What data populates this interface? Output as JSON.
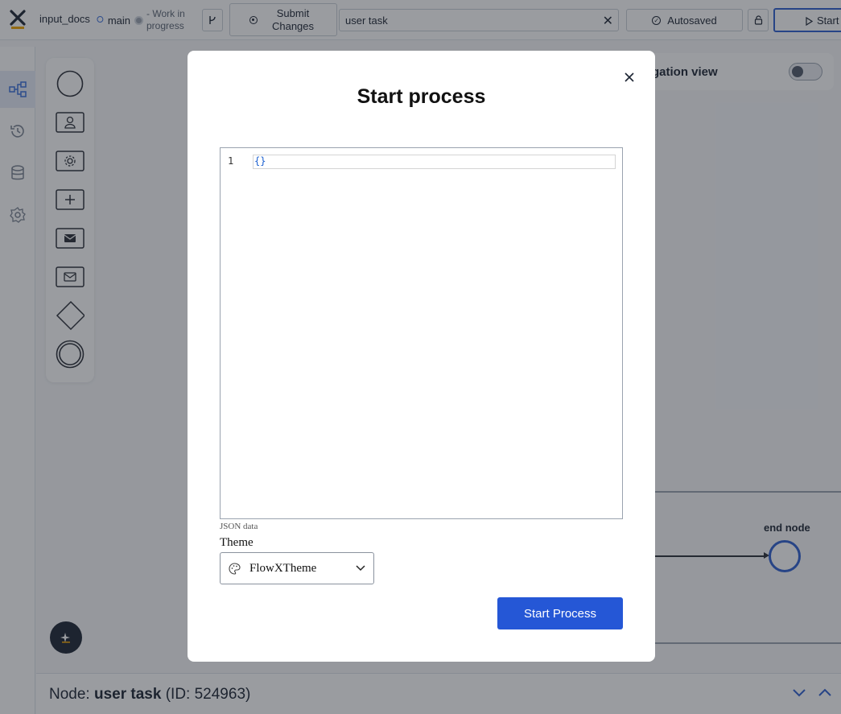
{
  "topbar": {
    "crumb": "input_docs",
    "branch": "main",
    "status": "- Work in progress",
    "submit_label": "Submit Changes",
    "search_value": "user task",
    "autosaved_label": "Autosaved",
    "start_label": "Start"
  },
  "canvas": {
    "navigation_view_label": "gation view",
    "end_node_label": "end node"
  },
  "bottom": {
    "prefix": "Node:",
    "node_name": "user task",
    "node_id": "(ID: 524963)"
  },
  "modal": {
    "title": "Start process",
    "editor": {
      "line_number": "1",
      "code": "{}"
    },
    "json_label": "JSON data",
    "theme_label": "Theme",
    "theme_value": "FlowXTheme",
    "start_button": "Start Process"
  },
  "colors": {
    "accent": "#2557d6",
    "logo_bar": "#f0a500"
  }
}
